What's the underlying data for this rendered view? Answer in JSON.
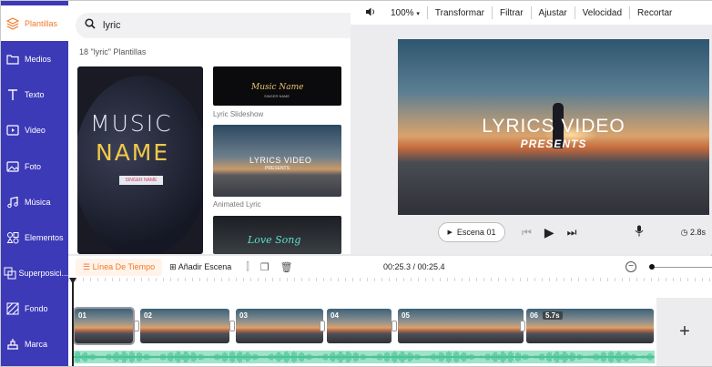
{
  "sidebar": {
    "items": [
      {
        "label": "Plantillas",
        "icon": "layers-icon",
        "active": true
      },
      {
        "label": "Medios",
        "icon": "folder-icon"
      },
      {
        "label": "Texto",
        "icon": "text-icon"
      },
      {
        "label": "Video",
        "icon": "video-icon"
      },
      {
        "label": "Foto",
        "icon": "image-icon"
      },
      {
        "label": "Música",
        "icon": "music-icon"
      },
      {
        "label": "Elementos",
        "icon": "shapes-icon"
      },
      {
        "label": "Superposici...",
        "icon": "overlay-icon"
      },
      {
        "label": "Fondo",
        "icon": "background-icon"
      },
      {
        "label": "Marca",
        "icon": "brand-icon"
      }
    ]
  },
  "templates": {
    "search_value": "lyric",
    "result_count": "18 \"lyric\" Plantillas",
    "big_thumb": {
      "line1": "MUSIC",
      "line2": "NAME",
      "tag": "SINGER NAME"
    },
    "thumb1": {
      "title": "Music Name",
      "sub": "SINGER NAME",
      "caption": "Lyric Slideshow"
    },
    "thumb2": {
      "title": "LYRICS VIDEO",
      "sub": "PRESENTS",
      "caption": "Animated Lyric"
    },
    "thumb3": {
      "title": "Love Song"
    }
  },
  "toolbar": {
    "zoom": "100%",
    "transform": "Transformar",
    "filter": "Filtrar",
    "adjust": "Ajustar",
    "speed": "Velocidad",
    "crop": "Recortar"
  },
  "preview": {
    "title": "LYRICS VIDEO",
    "subtitle": "PRESENTS",
    "scene_button": "Escena 01",
    "duration": "2.8s"
  },
  "timeline": {
    "tab_label": "Línea De Tiempo",
    "add_scene_label": "Añadir Escena",
    "time": "00:25.3 / 00:25.4",
    "scenes": [
      {
        "num": "01"
      },
      {
        "num": "02"
      },
      {
        "num": "03"
      },
      {
        "num": "04"
      },
      {
        "num": "05"
      },
      {
        "num": "06",
        "badge": "5.7s"
      }
    ],
    "add_button": "+"
  },
  "colors": {
    "sidebar": "#3d3ab8",
    "accent": "#f07a28",
    "waveform": "#9fe3c8"
  }
}
